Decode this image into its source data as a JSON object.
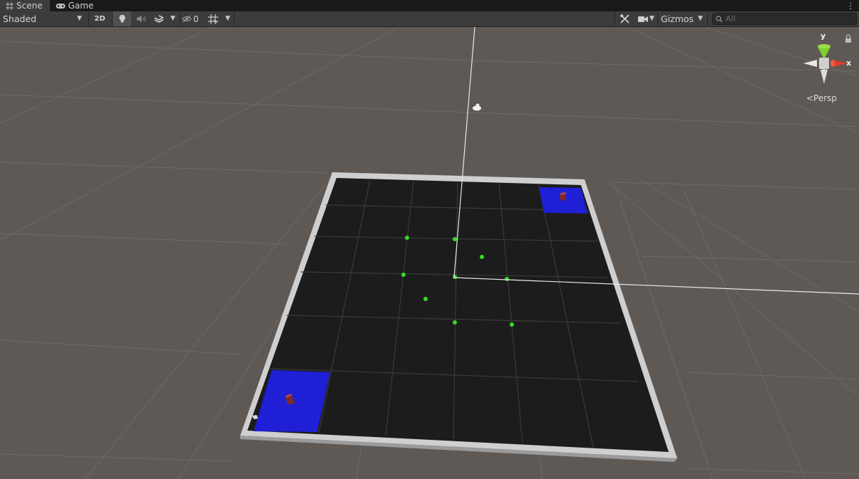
{
  "tabs": [
    {
      "label": "Scene",
      "active": true,
      "icon": "grid-icon"
    },
    {
      "label": "Game",
      "active": false,
      "icon": "gamepad-icon"
    }
  ],
  "toolbar": {
    "draw_mode": "Shaded",
    "toggle_2d": "2D",
    "hidden_count": "0",
    "gizmos_label": "Gizmos",
    "search_placeholder": "All"
  },
  "gizmo": {
    "y_label": "y",
    "x_label": "x",
    "projection_label": "<Persp"
  },
  "colors": {
    "tab_bar": "#191919",
    "toolbar": "#3c3c3c",
    "viewport_bg": "#5f5955",
    "board_floor": "#1f1f1f",
    "board_wall": "#c9c9c9",
    "goal_zone": "#1f1fd6",
    "agent_cube": "#8a2b2b",
    "waypoint": "#33dd22",
    "axis_x": "#e03a2a",
    "axis_y": "#7fd12a"
  }
}
